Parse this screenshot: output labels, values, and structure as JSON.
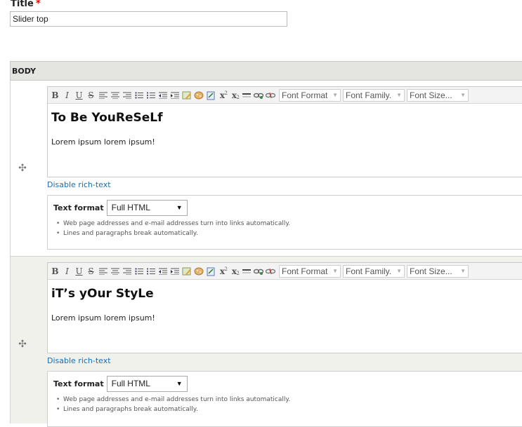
{
  "title": {
    "label": "Title",
    "required_mark": "*",
    "value": "Slider top"
  },
  "body_section": {
    "header": "BODY"
  },
  "toolbar": {
    "icons": [
      "bold-icon",
      "italic-icon",
      "underline-icon",
      "strikethrough-icon",
      "align-left-icon",
      "align-center-icon",
      "align-right-icon",
      "bullet-list-icon",
      "numbered-list-icon",
      "outdent-icon",
      "indent-icon",
      "edit-image-icon",
      "special-char-icon",
      "paste-icon",
      "superscript-icon",
      "subscript-icon",
      "horizontal-rule-icon",
      "link-icon",
      "unlink-icon"
    ],
    "font_format": "Font Format",
    "font_family": "Font Family.",
    "font_size": "Font Size..."
  },
  "items": [
    {
      "heading": "To Be YouReSeLf",
      "paragraph": "Lorem ipsum lorem ipsum!",
      "disable_link": "Disable rich-text",
      "text_format_label": "Text format",
      "text_format_value": "Full HTML",
      "tips": [
        "Web page addresses and e-mail addresses turn into links automatically.",
        "Lines and paragraphs break automatically."
      ]
    },
    {
      "heading": "iT’s yOur StyLe",
      "paragraph": "Lorem ipsum lorem ipsum!",
      "disable_link": "Disable rich-text",
      "text_format_label": "Text format",
      "text_format_value": "Full HTML",
      "tips": [
        "Web page addresses and e-mail addresses turn into links automatically.",
        "Lines and paragraphs break automatically."
      ]
    }
  ],
  "colors": {
    "link": "#1a6cb0",
    "required": "#e00000",
    "header_bg": "#e4e4e1",
    "alt_row_bg": "#f1f1ec"
  }
}
